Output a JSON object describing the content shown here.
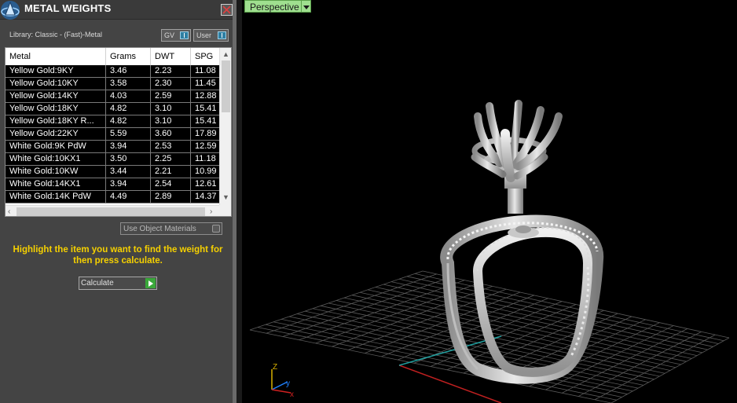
{
  "panel": {
    "title": "METAL WEIGHTS",
    "library": "Library: Classic - (Fast)-Metal",
    "gv_label": "GV",
    "user_label": "User",
    "use_object_materials": "Use Object Materials",
    "hint": "Highlight the item you want to find the weight for then press calculate.",
    "calculate_label": "Calculate"
  },
  "table": {
    "columns": [
      "Metal",
      "Grams",
      "DWT",
      "SPG"
    ],
    "rows": [
      [
        "Yellow Gold:9KY",
        "3.46",
        "2.23",
        "11.08"
      ],
      [
        "Yellow Gold:10KY",
        "3.58",
        "2.30",
        "11.45"
      ],
      [
        "Yellow Gold:14KY",
        "4.03",
        "2.59",
        "12.88"
      ],
      [
        "Yellow Gold:18KY",
        "4.82",
        "3.10",
        "15.41"
      ],
      [
        "Yellow Gold:18KY R...",
        "4.82",
        "3.10",
        "15.41"
      ],
      [
        "Yellow Gold:22KY",
        "5.59",
        "3.60",
        "17.89"
      ],
      [
        "White Gold:9K PdW",
        "3.94",
        "2.53",
        "12.59"
      ],
      [
        "White Gold:10KX1",
        "3.50",
        "2.25",
        "11.18"
      ],
      [
        "White Gold:10KW",
        "3.44",
        "2.21",
        "10.99"
      ],
      [
        "White Gold:14KX1",
        "3.94",
        "2.54",
        "12.61"
      ],
      [
        "White Gold:14K PdW",
        "4.49",
        "2.89",
        "14.37"
      ]
    ]
  },
  "viewport": {
    "label": "Perspective",
    "axis_z": "Z",
    "axis_y": "y",
    "axis_x": "x"
  }
}
